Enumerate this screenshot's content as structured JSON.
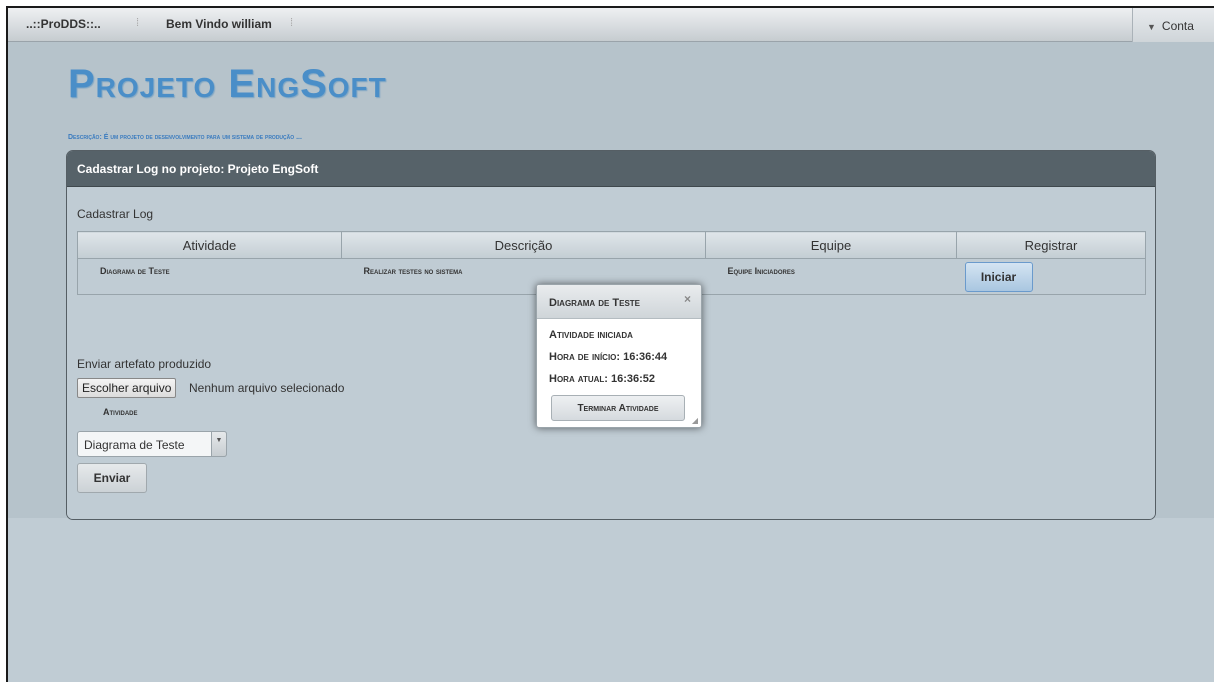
{
  "topbar": {
    "brand": "..::ProDDS::..",
    "welcome": "Bem Vindo william",
    "account": "Conta"
  },
  "project": {
    "title": "Projeto EngSoft",
    "description": "Descrição: É um projeto de desenvolvimento para um sistema de produção ..."
  },
  "panel": {
    "title": "Cadastrar Log no projeto: Projeto EngSoft",
    "section_label": "Cadastrar Log",
    "table": {
      "headers": [
        "Atividade",
        "Descrição",
        "Equipe",
        "Registrar"
      ],
      "rows": [
        {
          "atividade": "Diagrama de Teste",
          "descricao": "Realizar testes no sistema",
          "equipe": "Equipe Iniciadores",
          "action": "Iniciar"
        }
      ]
    },
    "upload": {
      "label": "Enviar artefato produzido",
      "file_button": "Escolher arquivo",
      "file_status": "Nenhum arquivo selecionado",
      "activity_label": "Atividade",
      "activity_selected": "Diagrama de Teste",
      "submit": "Enviar"
    }
  },
  "dialog": {
    "title": "Diagrama de Teste",
    "status": "Atividade iniciada",
    "start_time": "Hora de início: 16:36:44",
    "current_time": "Hora atual: 16:36:52",
    "finish_button": "Terminar Atividade"
  }
}
